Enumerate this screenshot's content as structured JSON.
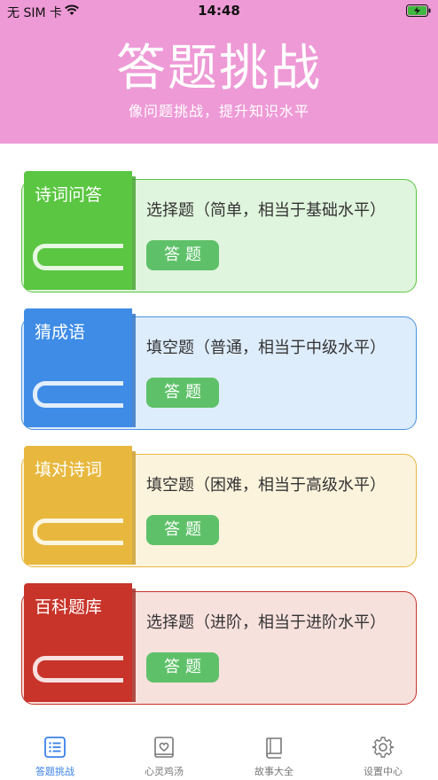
{
  "status_bar": {
    "carrier": "无 SIM 卡",
    "time": "14:48"
  },
  "header": {
    "title": "答题挑战",
    "subtitle": "像问题挑战，提升知识水平",
    "background": "#ee9ad6"
  },
  "cards": [
    {
      "label": "诗词问答",
      "desc": "选择题（简单，相当于基础水平）",
      "button": "答题",
      "book_color": "#5ac641",
      "book_dark": "#3f9e2b",
      "bg": "#e0f5dd",
      "border": "#5ac641"
    },
    {
      "label": "猜成语",
      "desc": "填空题（普通，相当于中级水平）",
      "button": "答题",
      "book_color": "#3e8ce6",
      "book_dark": "#2c6fc0",
      "bg": "#deedfc",
      "border": "#4a90e2"
    },
    {
      "label": "填对诗词",
      "desc": "填空题（困难，相当于高级水平）",
      "button": "答题",
      "book_color": "#e8b83e",
      "book_dark": "#c99a27",
      "bg": "#fbf3dc",
      "border": "#e8b83e"
    },
    {
      "label": "百科题库",
      "desc": "选择题（进阶，相当于进阶水平）",
      "button": "答题",
      "book_color": "#c8342a",
      "book_dark": "#9e2720",
      "bg": "#f7e1dd",
      "border": "#c8342a"
    }
  ],
  "tabs": [
    {
      "label": "答题挑战",
      "icon": "list-icon",
      "active": true
    },
    {
      "label": "心灵鸡汤",
      "icon": "heart-card-icon",
      "active": false
    },
    {
      "label": "故事大全",
      "icon": "book-icon",
      "active": false
    },
    {
      "label": "设置中心",
      "icon": "gear-icon",
      "active": false
    }
  ],
  "colors": {
    "accent": "#3b82e8",
    "button_green": "#5ec169"
  }
}
